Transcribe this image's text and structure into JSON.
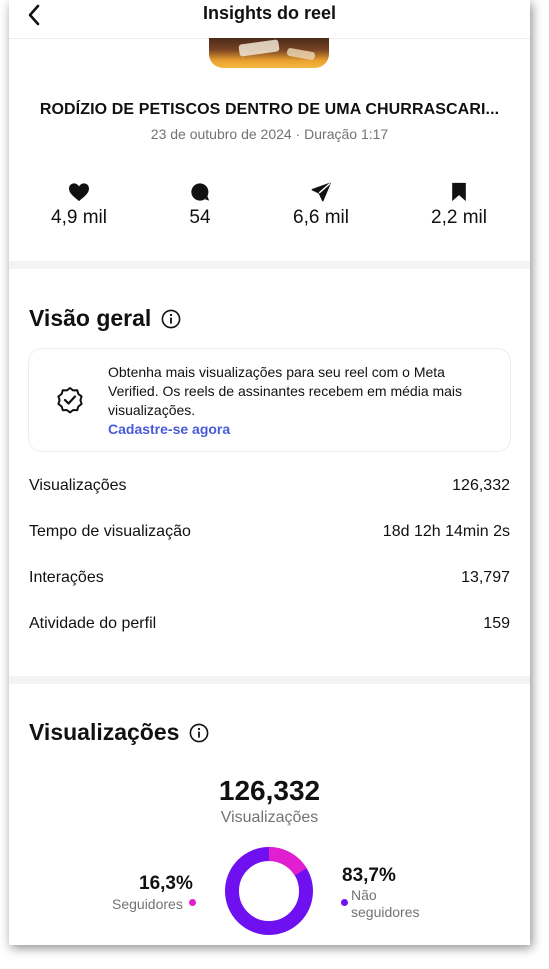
{
  "header": {
    "title": "Insights do reel"
  },
  "reel": {
    "title": "RODÍZIO DE PETISCOS DENTRO DE UMA CHURRASCARI...",
    "subtitle": "23 de outubro de 2024 · Duração 1:17"
  },
  "stats": [
    {
      "icon": "heart-icon",
      "value": "4,9 mil"
    },
    {
      "icon": "comment-icon",
      "value": "54"
    },
    {
      "icon": "share-icon",
      "value": "6,6 mil"
    },
    {
      "icon": "bookmark-icon",
      "value": "2,2 mil"
    }
  ],
  "overview": {
    "title": "Visão geral",
    "promo_text": "Obtenha mais visualizações para seu reel com o Meta Verified. Os reels de assinantes recebem em média mais visualizações.",
    "promo_link": "Cadastre-se agora",
    "metrics": [
      {
        "label": "Visualizações",
        "value": "126,332"
      },
      {
        "label": "Tempo de visualização",
        "value": "18d 12h 14min 2s"
      },
      {
        "label": "Interações",
        "value": "13,797"
      },
      {
        "label": "Atividade do perfil",
        "value": "159"
      }
    ]
  },
  "views": {
    "title": "Visualizações",
    "total": "126,332",
    "total_label": "Visualizações",
    "followers_pct": "16,3%",
    "followers_label": "Seguidores",
    "non_followers_pct": "83,7%",
    "non_followers_label_1": "Não",
    "non_followers_label_2": "seguidores",
    "followers_fraction": 0.163,
    "colors": {
      "followers": "#e11fd0",
      "non_followers": "#6f10f0"
    }
  },
  "colors": {
    "link": "#4a5bd8",
    "muted": "#737373"
  }
}
